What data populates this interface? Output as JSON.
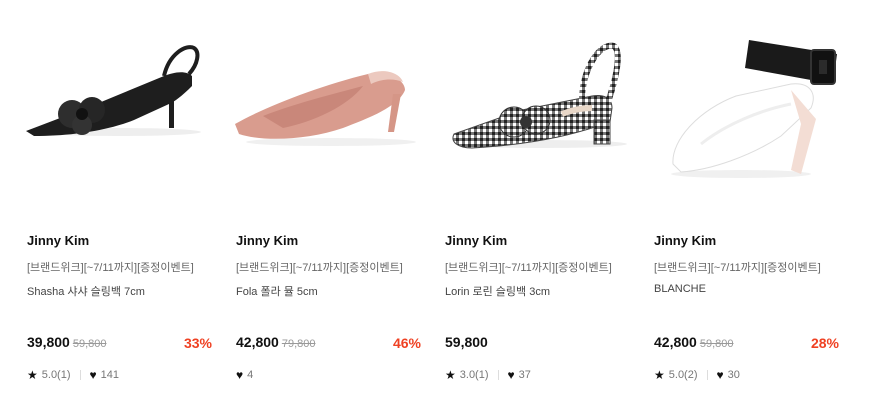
{
  "colors": {
    "discount": "#ef4123",
    "text": "#111111",
    "muted": "#999999"
  },
  "icons": {
    "rating": "star-icon",
    "likes": "heart-icon"
  },
  "products": [
    {
      "brand": "Jinny Kim",
      "promo": "[브랜드위크][~7/11까지][증정이벤트]",
      "name": "Shasha 샤샤 슬링백 7cm",
      "price": "39,800",
      "original_price": "59,800",
      "discount": "33%",
      "rating": "5.0(1)",
      "likes": "141"
    },
    {
      "brand": "Jinny Kim",
      "promo": "[브랜드위크][~7/11까지][증정이벤트]",
      "name": "Fola 폴라 뮬 5cm",
      "price": "42,800",
      "original_price": "79,800",
      "discount": "46%",
      "likes": "4"
    },
    {
      "brand": "Jinny Kim",
      "promo": "[브랜드위크][~7/11까지][증정이벤트]",
      "name": "Lorin 로린 슬링백 3cm",
      "price": "59,800",
      "rating": "3.0(1)",
      "likes": "37"
    },
    {
      "brand": "Jinny Kim",
      "promo": "[브랜드위크][~7/11까지][증정이벤트]",
      "name": "BLANCHE",
      "price": "42,800",
      "original_price": "59,800",
      "discount": "28%",
      "rating": "5.0(2)",
      "likes": "30"
    }
  ]
}
